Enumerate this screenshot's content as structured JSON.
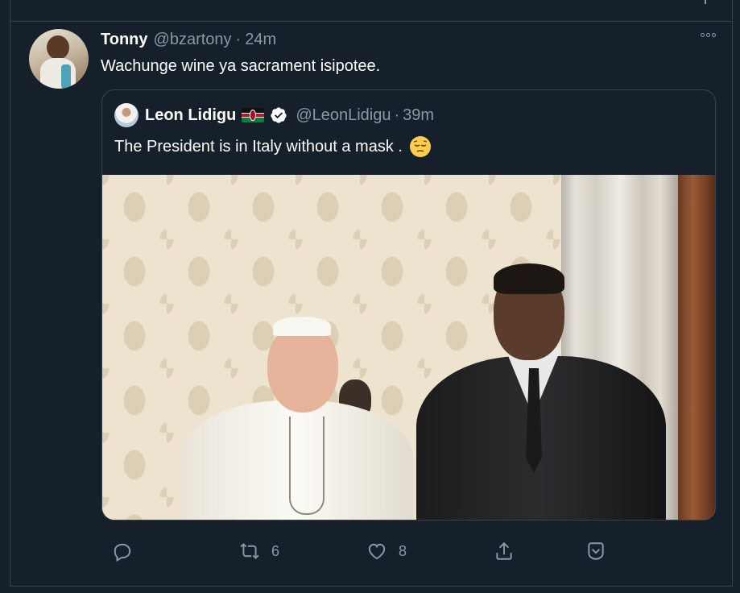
{
  "tweet": {
    "author_name": "Tonny",
    "author_handle": "@bzartony",
    "separator": "·",
    "time": "24m",
    "text": "Wachunge wine ya sacrament isipotee."
  },
  "quoted": {
    "author_name": "Leon Lidigu",
    "author_handle": "@LeonLidigu",
    "separator": "·",
    "time": "39m",
    "text": "The President is in Italy without a mask .",
    "emoji": "pensive-face-emoji",
    "flag": "kenya-flag",
    "verified": true
  },
  "actions": {
    "reply_count": "",
    "retweet_count": "6",
    "like_count": "8"
  },
  "colors": {
    "background": "#15202b",
    "border": "#38444d",
    "secondary_text": "#8899a6",
    "primary_text": "#ffffff",
    "verified_badge": "#ffffff"
  },
  "icons": [
    "more-options-icon",
    "reply-icon",
    "retweet-icon",
    "like-icon",
    "share-icon",
    "bookmark-icon",
    "verified-icon"
  ]
}
